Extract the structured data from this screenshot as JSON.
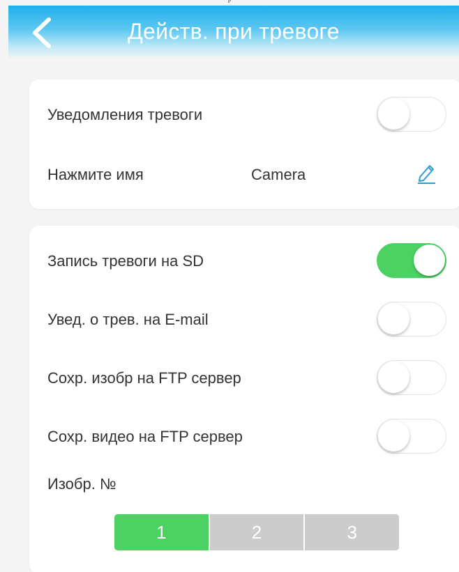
{
  "caption": "p",
  "header": {
    "back_icon": "chevron-left-icon",
    "title": "Действ. при тревоге",
    "gradient_top": "#1fb0ea",
    "title_color": "#ffffff"
  },
  "card1": {
    "notify": {
      "label": "Уведомления тревоги",
      "enabled": false
    },
    "name": {
      "label": "Нажмите имя",
      "value": "Camera",
      "edit_icon": "pencil-icon"
    }
  },
  "card2": {
    "rows": [
      {
        "label": "Запись тревоги на SD",
        "enabled": true
      },
      {
        "label": "Увед. о трев. на E-mail",
        "enabled": false
      },
      {
        "label": "Сохр. изобр на FTP сервер",
        "enabled": false
      },
      {
        "label": "Сохр. видео на FTP сервер",
        "enabled": false
      }
    ],
    "image_count": {
      "label": "Изобр. №",
      "options": [
        "1",
        "2",
        "3"
      ],
      "selected": "1"
    }
  },
  "colors": {
    "accent_green": "#4bd263",
    "inactive_gray": "#cccccc",
    "edit_blue": "#2a9fd6"
  }
}
